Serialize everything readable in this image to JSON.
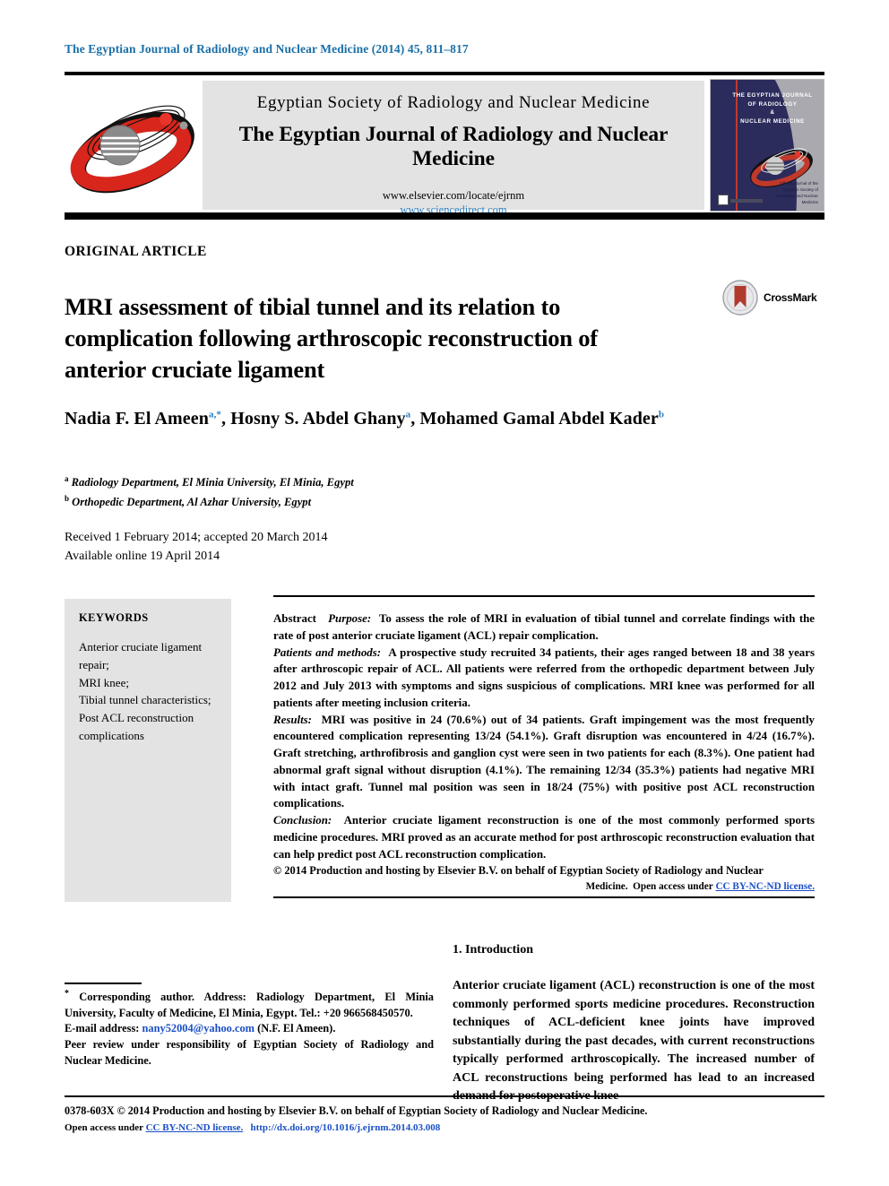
{
  "running_head": "The Egyptian Journal of Radiology and Nuclear Medicine (2014) 45, 811–817",
  "banner": {
    "society": "Egyptian Society of Radiology and Nuclear Medicine",
    "journal": "The Egyptian Journal of Radiology and Nuclear Medicine",
    "url_elsevier": "www.elsevier.com/locate/ejrnm",
    "url_sciencedirect": "www.sciencedirect.com",
    "logo_icon": "journal-swoosh-logo",
    "cover": {
      "title_line1": "THE EGYPTIAN JOURNAL",
      "title_line2": "OF RADIOLOGY",
      "title_line3": "&",
      "title_line4": "NUCLEAR MEDICINE",
      "footer_right": "Official Journal of the Egyptian Society of Radiology and Nuclear Medicine"
    }
  },
  "article": {
    "type_label": "ORIGINAL ARTICLE",
    "title": "MRI assessment of tibial tunnel and its relation to complication following arthroscopic reconstruction of anterior cruciate ligament",
    "crossmark_label": "CrossMark",
    "authors": [
      {
        "name": "Nadia F. El Ameen",
        "marks": "a,*"
      },
      {
        "name": "Hosny S. Abdel Ghany",
        "marks": "a"
      },
      {
        "name": "Mohamed Gamal Abdel Kader",
        "marks": "b"
      }
    ],
    "affiliations": [
      {
        "mark": "a",
        "text": "Radiology Department, El Minia University, El Minia, Egypt"
      },
      {
        "mark": "b",
        "text": "Orthopedic Department, Al Azhar University, Egypt"
      }
    ],
    "received": "Received 1 February 2014; accepted 20 March 2014",
    "available": "Available online 19 April 2014"
  },
  "keywords": {
    "heading": "KEYWORDS",
    "items": [
      "Anterior cruciate ligament repair;",
      "MRI knee;",
      "Tibial tunnel characteristics;",
      "Post ACL reconstruction complications"
    ]
  },
  "abstract": {
    "label": "Abstract",
    "purpose_label": "Purpose:",
    "purpose_text": "To assess the role of MRI in evaluation of tibial tunnel and correlate findings with the rate of post anterior cruciate ligament (ACL) repair complication.",
    "methods_label": "Patients and methods:",
    "methods_text": "A prospective study recruited 34 patients, their ages ranged between 18 and 38 years after arthroscopic repair of ACL. All patients were referred from the orthopedic department between July 2012 and July 2013 with symptoms and signs suspicious of complications. MRI knee was performed for all patients after meeting inclusion criteria.",
    "results_label": "Results:",
    "results_text": "MRI was positive in 24 (70.6%) out of 34 patients. Graft impingement was the most frequently encountered complication representing 13/24 (54.1%). Graft disruption was encountered in 4/24 (16.7%). Graft stretching, arthrofibrosis and ganglion cyst were seen in two patients for each (8.3%). One patient had abnormal graft signal without disruption (4.1%). The remaining 12/34 (35.3%) patients had negative MRI with intact graft. Tunnel mal position was seen in 18/24 (75%) with positive post ACL reconstruction complications.",
    "conclusion_label": "Conclusion:",
    "conclusion_text": "Anterior cruciate ligament reconstruction is one of the most commonly performed sports medicine procedures. MRI proved as an accurate method for post arthroscopic reconstruction evaluation that can help predict post ACL reconstruction complication.",
    "copyright": "© 2014 Production and hosting by Elsevier B.V. on behalf of Egyptian Society of Radiology and Nuclear",
    "copyright_tail": "Medicine.",
    "open_access_prefix": "Open access under",
    "open_access_link": "CC BY-NC-ND license."
  },
  "introduction": {
    "heading": "1. Introduction",
    "body": "Anterior cruciate ligament (ACL) reconstruction is one of the most commonly performed sports medicine procedures. Reconstruction techniques of ACL-deficient knee joints have improved substantially during the past decades, with current reconstructions typically performed arthroscopically. The increased number of ACL reconstructions being performed has lead to an increased demand for postoperative knee"
  },
  "footnote": {
    "corresponding": "Corresponding author. Address: Radiology Department, El Minia University, Faculty of Medicine, El Minia, Egypt. Tel.: +20 966568450570.",
    "email_label": "E-mail address:",
    "email": "nany52004@yahoo.com",
    "email_suffix": "(N.F. El Ameen).",
    "peer_review": "Peer review under responsibility of Egyptian Society of Radiology and Nuclear Medicine."
  },
  "imprint": {
    "line1": "0378-603X © 2014 Production and hosting by Elsevier B.V. on behalf of Egyptian Society of Radiology and Nuclear Medicine.",
    "open_access_prefix": "Open access under",
    "open_access_link": "CC BY-NC-ND license.",
    "doi": "http://dx.doi.org/10.1016/j.ejrnm.2014.03.008"
  },
  "colors": {
    "running_head": "#1a6fa8",
    "link_blue": "#1a4fc4",
    "sciencedirect_blue": "#2a7fc1",
    "gray_panel": "#e3e3e3",
    "cover_navy": "#2b2b5c",
    "logo_red": "#d8261c",
    "crossmark_red": "#b03a2e"
  }
}
